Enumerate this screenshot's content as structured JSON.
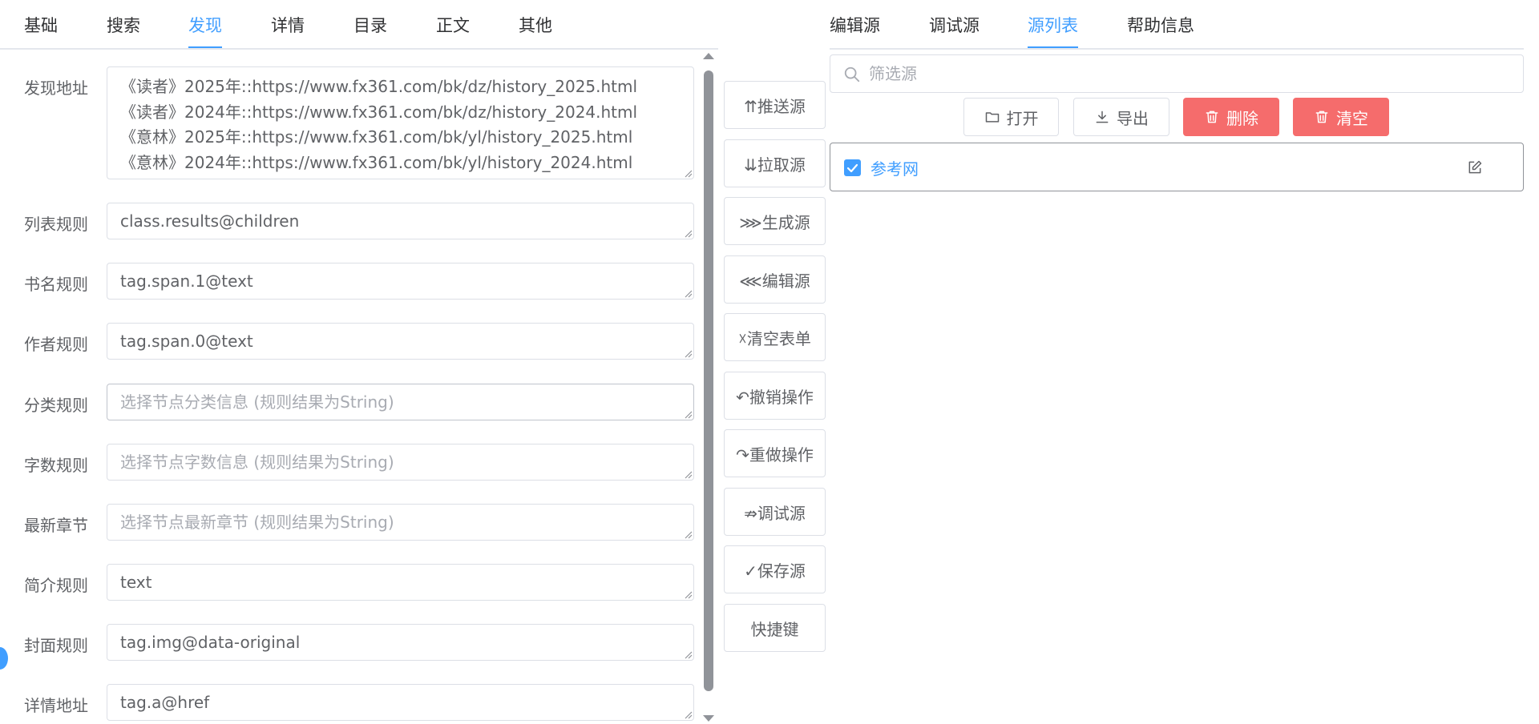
{
  "left_tabs": [
    "基础",
    "搜索",
    "发现",
    "详情",
    "目录",
    "正文",
    "其他"
  ],
  "left_active_tab": "发现",
  "form": [
    {
      "label": "发现地址",
      "value": "《读者》2025年::https://www.fx361.com/bk/dz/history_2025.html\n《读者》2024年::https://www.fx361.com/bk/dz/history_2024.html\n《意林》2025年::https://www.fx361.com/bk/yl/history_2025.html\n《意林》2024年::https://www.fx361.com/bk/yl/history_2024.html",
      "placeholder": ""
    },
    {
      "label": "列表规则",
      "value": "class.results@children",
      "placeholder": ""
    },
    {
      "label": "书名规则",
      "value": "tag.span.1@text",
      "placeholder": ""
    },
    {
      "label": "作者规则",
      "value": "tag.span.0@text",
      "placeholder": ""
    },
    {
      "label": "分类规则",
      "value": "",
      "placeholder": "选择节点分类信息 (规则结果为String)"
    },
    {
      "label": "字数规则",
      "value": "",
      "placeholder": "选择节点字数信息 (规则结果为String)"
    },
    {
      "label": "最新章节",
      "value": "",
      "placeholder": "选择节点最新章节 (规则结果为String)"
    },
    {
      "label": "简介规则",
      "value": "text",
      "placeholder": ""
    },
    {
      "label": "封面规则",
      "value": "tag.img@data-original",
      "placeholder": ""
    },
    {
      "label": "详情地址",
      "value": "tag.a@href",
      "placeholder": ""
    }
  ],
  "actions": [
    "⇈推送源",
    "⇊拉取源",
    "⋙生成源",
    "⋘编辑源",
    "☓清空表单",
    "↶撤销操作",
    "↷重做操作",
    "⇏调试源",
    "✓保存源",
    "快捷键"
  ],
  "right_tabs": [
    "编辑源",
    "调试源",
    "源列表",
    "帮助信息"
  ],
  "right_active_tab": "源列表",
  "search": {
    "placeholder": "筛选源",
    "value": ""
  },
  "source_buttons": {
    "open": "打开",
    "export": "导出",
    "delete": "删除",
    "clear": "清空"
  },
  "sources": [
    {
      "name": "参考网",
      "checked": true
    }
  ],
  "colors": {
    "accent": "#409eff",
    "danger": "#f56c6c",
    "border": "#dcdfe6",
    "placeholder": "#a8abb2"
  }
}
